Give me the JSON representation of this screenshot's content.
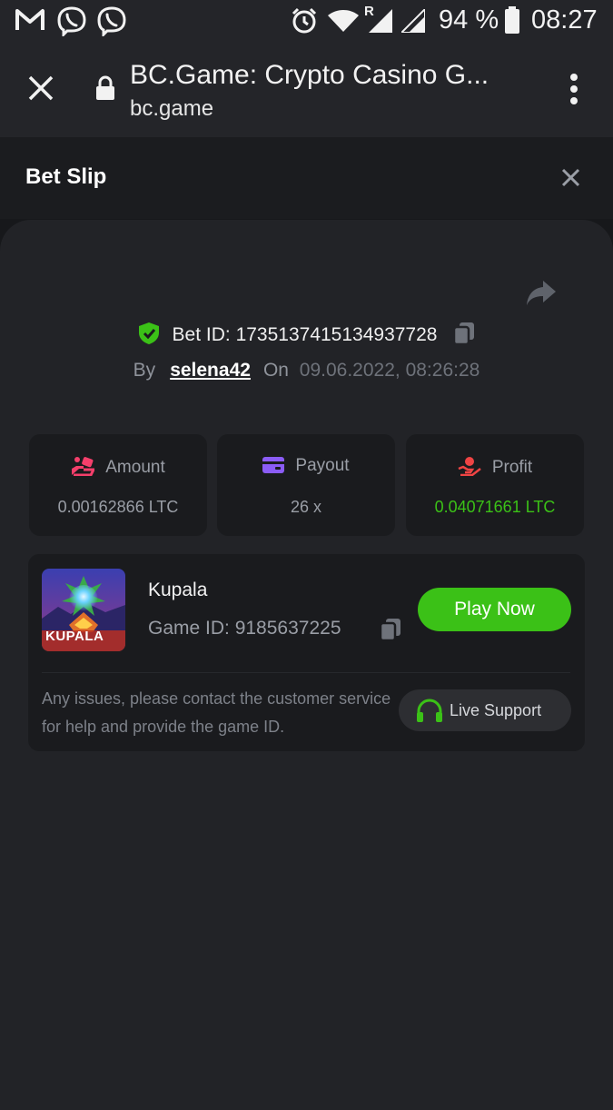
{
  "status_bar": {
    "battery": "94 %",
    "time": "08:27",
    "roaming_indicator": "R",
    "icons": [
      "gmail-icon",
      "viber-icon",
      "viber-icon",
      "alarm-icon",
      "wifi-icon",
      "signal-icon",
      "signal-icon",
      "battery-icon"
    ]
  },
  "browser": {
    "title": "BC.Game: Crypto Casino G...",
    "url": "bc.game"
  },
  "bet_slip": {
    "title": "Bet Slip",
    "bet_id_label": "Bet ID:",
    "bet_id": "1735137415134937728",
    "by_label": "By",
    "username": "selena42",
    "on_label": "On",
    "datetime": "09.06.2022, 08:26:28",
    "stats": {
      "amount_label": "Amount",
      "amount_value": "0.00162866 LTC",
      "payout_label": "Payout",
      "payout_value": "26 x",
      "profit_label": "Profit",
      "profit_value": "0.04071661 LTC"
    },
    "game": {
      "name": "Kupala",
      "game_id_label": "Game ID:",
      "game_id": "9185637225",
      "thumb_logo": "KUPALA",
      "play_label": "Play Now"
    },
    "support_text": "Any issues, please contact the customer service for help and provide the game ID.",
    "support_button": "Live Support"
  },
  "colors": {
    "accent_green": "#3bc117",
    "background": "#17181b",
    "panel": "#222327",
    "card": "#1a1b1e"
  }
}
